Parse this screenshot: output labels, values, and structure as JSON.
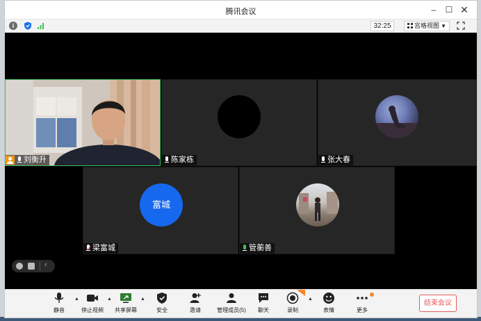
{
  "window": {
    "title": "腾讯会议",
    "controls": {
      "minimize": "–",
      "maximize": "☐",
      "close": "✕"
    }
  },
  "infobar": {
    "timer": "32:25",
    "view_mode": "宫格视图"
  },
  "participants": [
    {
      "name": "刘衡升",
      "host": true,
      "speaking": true,
      "video": true
    },
    {
      "name": "陈家栋",
      "avatar": "black-circle"
    },
    {
      "name": "张大春",
      "avatar": "photo"
    },
    {
      "name": "梁富城",
      "avatar": "initials",
      "avatar_text": "富城",
      "avatar_color": "#1668ee",
      "mic_muted": true
    },
    {
      "name": "管蘅善",
      "avatar": "photo",
      "mic_active": true
    }
  ],
  "toolbar": {
    "mute": "静音",
    "stop_video": "停止视频",
    "share_screen": "共享屏幕",
    "security": "安全",
    "invite": "邀请",
    "manage_members": "管理成员(5)",
    "chat": "聊天",
    "record": "录制",
    "reactions": "表情",
    "more": "更多",
    "end_meeting": "结束会议"
  },
  "colors": {
    "accent_green": "#3fbf5e",
    "end_button_red": "#e35b5b",
    "avatar_blue": "#1668ee",
    "host_orange": "#f09a1a"
  }
}
